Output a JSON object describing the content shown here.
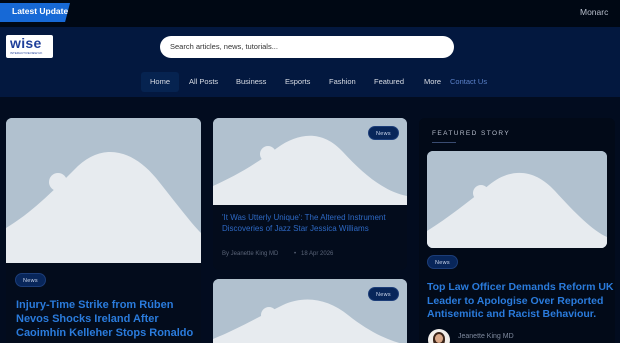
{
  "topbar": {
    "latest_label": "Latest Update",
    "ticker_text": "Monarc"
  },
  "header": {
    "logo_text": "wise",
    "logo_sub": "INTERACTIVEVIEW.UK",
    "search_placeholder": "Search articles, news, tutorials...",
    "nav": [
      "Home",
      "All Posts",
      "Business",
      "Esports",
      "Fashion",
      "Featured",
      "More",
      "Contact Us"
    ]
  },
  "articles": [
    {
      "tag": "News",
      "title": "Injury-Time Strike from Rúben Nevos Shocks Ireland After Caoimhín Kelleher Stops Ronaldo"
    },
    {
      "tag": "News",
      "title": "'It Was Utterly Unique': The Altered Instrument Discoveries of Jazz Star Jessica Williams",
      "author": "By Jeanette King MD",
      "date": "18 Apr 2026"
    },
    {
      "tag": "News"
    }
  ],
  "featured": {
    "label": "FEATURED STORY",
    "tag": "News",
    "title": "Top Law Officer Demands Reform UK Leader to Apologise Over Reported Antisemitic and Racist Behaviour.",
    "author": "Jeanette King MD"
  },
  "colors": {
    "background": "#020c1f",
    "header": "#03183f",
    "accent": "#1769d6",
    "title_blue": "#2a7bdc"
  }
}
